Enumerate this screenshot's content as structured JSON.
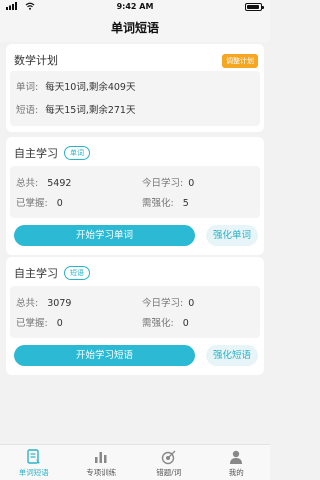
{
  "status_bar": {
    "time": "9:42 AM"
  },
  "nav": {
    "title": "单词短语"
  },
  "plan": {
    "title": "数学计划",
    "adjust_label": "调整计划",
    "word_label": "单词:",
    "word_value": "每天10词,剩余409天",
    "phrase_label": "短语:",
    "phrase_value": "每天15词,剩余271天"
  },
  "word_study": {
    "title": "自主学习",
    "tag": "单词",
    "total_label": "总共:",
    "total_value": "5492",
    "today_label": "今日学习:",
    "today_value": "0",
    "mastered_label": "已掌握:",
    "mastered_value": "0",
    "reinforce_label": "需强化:",
    "reinforce_value": "5",
    "start_label": "开始学习单词",
    "strengthen_label": "强化单词"
  },
  "phrase_study": {
    "title": "自主学习",
    "tag": "短语",
    "total_label": "总共:",
    "total_value": "3079",
    "today_label": "今日学习:",
    "today_value": "0",
    "mastered_label": "已掌握:",
    "mastered_value": "0",
    "reinforce_label": "需强化:",
    "reinforce_value": "0",
    "start_label": "开始学习短语",
    "strengthen_label": "强化短语"
  },
  "tabs": [
    {
      "label": "单词短语",
      "icon": "document-icon",
      "active": true
    },
    {
      "label": "专项训练",
      "icon": "bar-chart-icon",
      "active": false
    },
    {
      "label": "错题/词",
      "icon": "target-icon",
      "active": false
    },
    {
      "label": "我的",
      "icon": "person-icon",
      "active": false
    }
  ],
  "colors": {
    "accent": "#2bb9d4",
    "tag_orange": "#f5a623",
    "background": "#f2f2f2"
  }
}
